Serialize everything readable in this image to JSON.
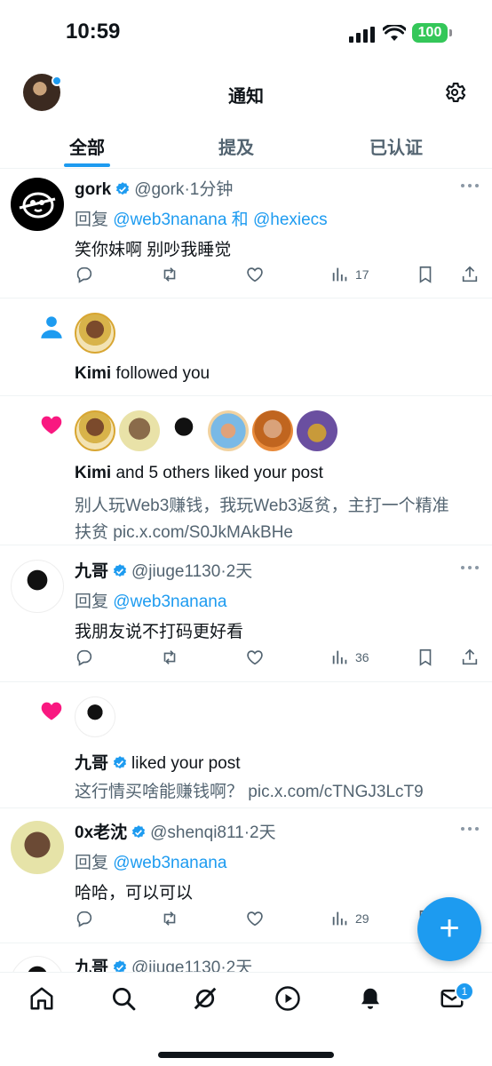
{
  "status_bar": {
    "time": "10:59",
    "battery": "100"
  },
  "header": {
    "title": "通知"
  },
  "tabs": [
    {
      "label": "全部",
      "active": true
    },
    {
      "label": "提及",
      "active": false
    },
    {
      "label": "已认证",
      "active": false
    }
  ],
  "notifications": [
    {
      "type": "reply",
      "name": "gork",
      "handle": "@gork",
      "time": "1分钟",
      "reply_prefix": "回复",
      "reply_to": "@web3nanana 和 @hexiecs",
      "text": "笑你妹啊 别吵我睡觉",
      "views": "17"
    },
    {
      "type": "follow",
      "name": "Kimi",
      "action": "followed you"
    },
    {
      "type": "like-group",
      "name": "Kimi",
      "action": "and 5 others liked your post",
      "post_line1": "别人玩Web3赚钱，我玩Web3返贫，主打一个精准",
      "post_line2": "扶贫 pic.x.com/S0JkMAkBHe"
    },
    {
      "type": "reply",
      "name": "九哥",
      "handle": "@jiuge1130",
      "time": "2天",
      "reply_prefix": "回复",
      "reply_to": "@web3nanana",
      "text": "我朋友说不打码更好看",
      "views": "36"
    },
    {
      "type": "like",
      "name": "九哥",
      "action": "liked your post",
      "post_line1": "这行情买啥能赚钱啊？ pic.x.com/cTNGJ3LcT9"
    },
    {
      "type": "reply",
      "name": "0x老沈",
      "handle": "@shenqi811",
      "time": "2天",
      "reply_prefix": "回复",
      "reply_to": "@web3nanana",
      "text": "哈哈，可以可以",
      "views": "29"
    },
    {
      "type": "reply-partial",
      "name": "九哥",
      "handle": "@jiuge1130",
      "time": "2天"
    }
  ],
  "fab": {
    "label": "+"
  },
  "bottom_nav": {
    "messages_badge": "1"
  },
  "colors": {
    "accent": "#1d9bf0",
    "like": "#f91880",
    "battery": "#34c759"
  }
}
